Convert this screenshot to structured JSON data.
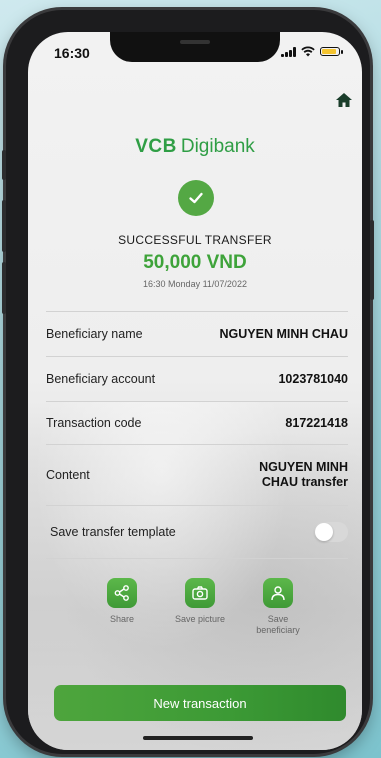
{
  "status_bar": {
    "time": "16:30"
  },
  "brand": {
    "part1": "VCB",
    "part2": "Digibank"
  },
  "result": {
    "title": "SUCCESSFUL TRANSFER",
    "amount": "50,000 VND",
    "timestamp": "16:30 Monday 11/07/2022"
  },
  "details": [
    {
      "label": "Beneficiary name",
      "value": "NGUYEN MINH CHAU"
    },
    {
      "label": "Beneficiary account",
      "value": "1023781040"
    },
    {
      "label": "Transaction code",
      "value": "817221418"
    },
    {
      "label": "Content",
      "value_line1": "NGUYEN MINH",
      "value_line2": "CHAU transfer"
    }
  ],
  "save_template": {
    "label": "Save transfer template",
    "enabled": false
  },
  "actions": [
    {
      "icon": "share-icon",
      "label": "Share"
    },
    {
      "icon": "camera-icon",
      "label": "Save picture"
    },
    {
      "icon": "user-icon",
      "label_line1": "Save",
      "label_line2": "beneficiary"
    }
  ],
  "cta": {
    "label": "New transaction"
  },
  "colors": {
    "brand_green": "#2f9e45",
    "accent_green": "#3ea33a",
    "button_green": "#3c9a35"
  }
}
